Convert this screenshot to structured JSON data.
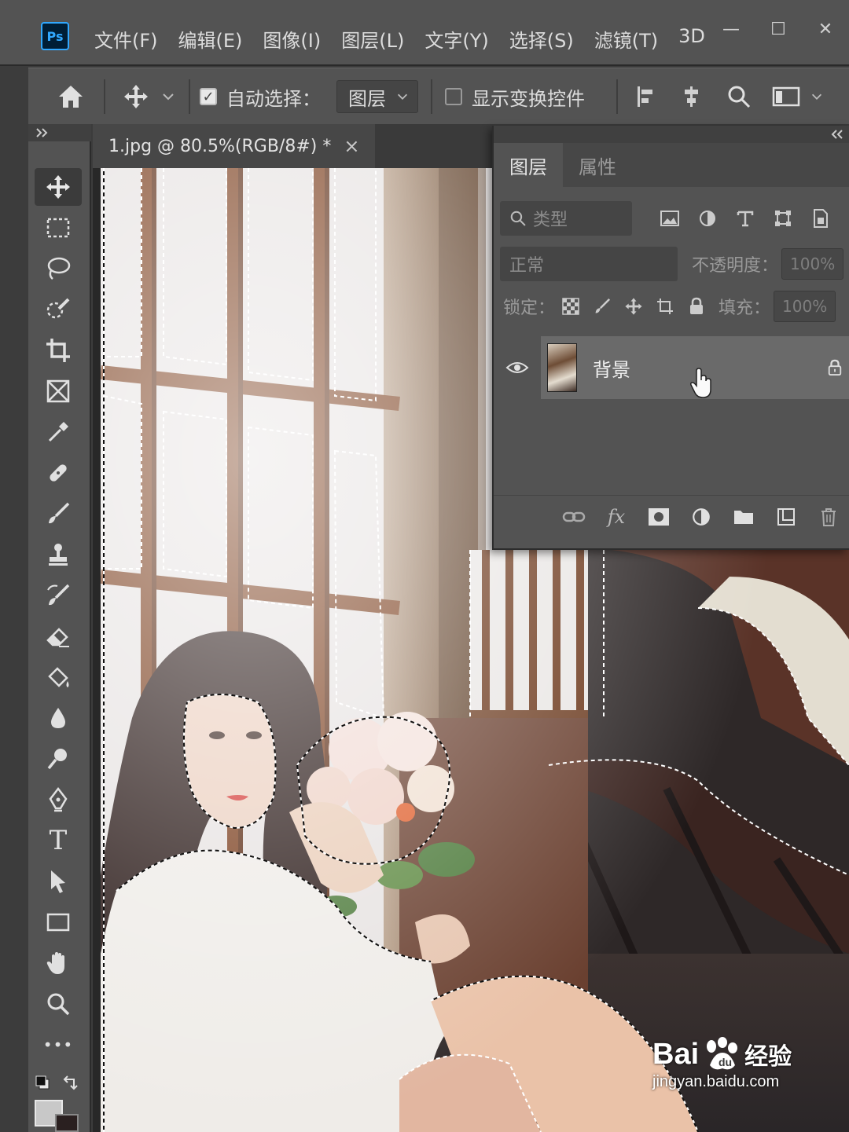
{
  "app": {
    "logo": "Ps",
    "menu": [
      "文件(F)",
      "编辑(E)",
      "图像(I)",
      "图层(L)",
      "文字(Y)",
      "选择(S)",
      "滤镜(T)",
      "3D"
    ],
    "window_controls": [
      "—",
      "☐",
      "✕"
    ]
  },
  "options_bar": {
    "auto_select_label": "自动选择：",
    "auto_select_checked": true,
    "auto_select_target": "图层",
    "show_transform_label": "显示变换控件",
    "show_transform_checked": false
  },
  "document": {
    "tab_title": "1.jpg @ 80.5%(RGB/8#) *",
    "close_glyph": "×"
  },
  "toolbar": {
    "tools": [
      "move-tool",
      "rectangular-marquee-tool",
      "lasso-tool",
      "quick-selection-tool",
      "crop-tool",
      "frame-tool",
      "eyedropper-tool",
      "healing-brush-tool",
      "brush-tool",
      "clone-stamp-tool",
      "history-brush-tool",
      "eraser-tool",
      "paint-bucket-tool",
      "blur-tool",
      "dodge-tool",
      "pen-tool",
      "type-tool",
      "path-selection-tool",
      "rectangle-tool",
      "hand-tool",
      "zoom-tool",
      "more-tools"
    ],
    "type_glyph": "T",
    "more_glyph": "•••"
  },
  "layers_panel": {
    "tabs": [
      "图层",
      "属性"
    ],
    "filter_placeholder": "类型",
    "blend_mode": "正常",
    "opacity_label": "不透明度：",
    "opacity_value": "100%",
    "lock_label": "锁定：",
    "fill_label": "填充：",
    "fill_value": "100%",
    "layers": [
      {
        "name": "背景",
        "visible": true,
        "locked": true
      }
    ],
    "bottom_fx": "fx"
  },
  "watermark": {
    "brand_left": "Bai",
    "brand_right": "经验",
    "url": "jingyan.baidu.com"
  },
  "colors": {
    "accent": "#31a8ff",
    "panel_bg": "#535353",
    "menu_bg": "#535353"
  }
}
